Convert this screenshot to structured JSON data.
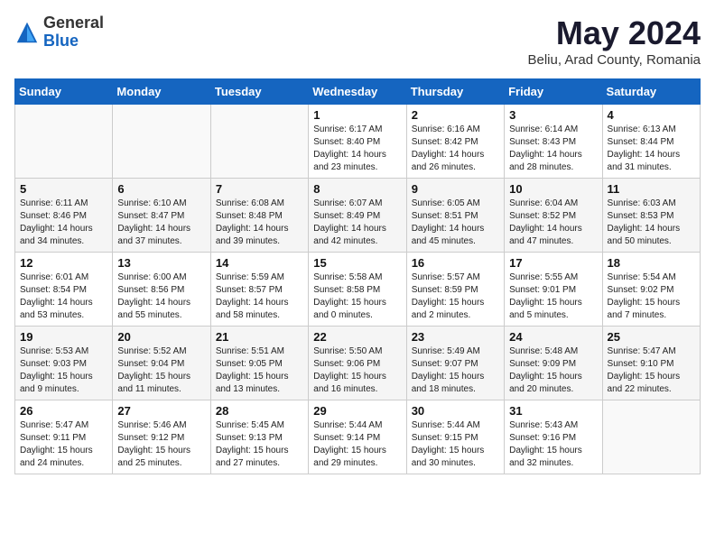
{
  "header": {
    "logo_general": "General",
    "logo_blue": "Blue",
    "month_title": "May 2024",
    "subtitle": "Beliu, Arad County, Romania"
  },
  "weekdays": [
    "Sunday",
    "Monday",
    "Tuesday",
    "Wednesday",
    "Thursday",
    "Friday",
    "Saturday"
  ],
  "weeks": [
    [
      {
        "day": "",
        "info": ""
      },
      {
        "day": "",
        "info": ""
      },
      {
        "day": "",
        "info": ""
      },
      {
        "day": "1",
        "info": "Sunrise: 6:17 AM\nSunset: 8:40 PM\nDaylight: 14 hours\nand 23 minutes."
      },
      {
        "day": "2",
        "info": "Sunrise: 6:16 AM\nSunset: 8:42 PM\nDaylight: 14 hours\nand 26 minutes."
      },
      {
        "day": "3",
        "info": "Sunrise: 6:14 AM\nSunset: 8:43 PM\nDaylight: 14 hours\nand 28 minutes."
      },
      {
        "day": "4",
        "info": "Sunrise: 6:13 AM\nSunset: 8:44 PM\nDaylight: 14 hours\nand 31 minutes."
      }
    ],
    [
      {
        "day": "5",
        "info": "Sunrise: 6:11 AM\nSunset: 8:46 PM\nDaylight: 14 hours\nand 34 minutes."
      },
      {
        "day": "6",
        "info": "Sunrise: 6:10 AM\nSunset: 8:47 PM\nDaylight: 14 hours\nand 37 minutes."
      },
      {
        "day": "7",
        "info": "Sunrise: 6:08 AM\nSunset: 8:48 PM\nDaylight: 14 hours\nand 39 minutes."
      },
      {
        "day": "8",
        "info": "Sunrise: 6:07 AM\nSunset: 8:49 PM\nDaylight: 14 hours\nand 42 minutes."
      },
      {
        "day": "9",
        "info": "Sunrise: 6:05 AM\nSunset: 8:51 PM\nDaylight: 14 hours\nand 45 minutes."
      },
      {
        "day": "10",
        "info": "Sunrise: 6:04 AM\nSunset: 8:52 PM\nDaylight: 14 hours\nand 47 minutes."
      },
      {
        "day": "11",
        "info": "Sunrise: 6:03 AM\nSunset: 8:53 PM\nDaylight: 14 hours\nand 50 minutes."
      }
    ],
    [
      {
        "day": "12",
        "info": "Sunrise: 6:01 AM\nSunset: 8:54 PM\nDaylight: 14 hours\nand 53 minutes."
      },
      {
        "day": "13",
        "info": "Sunrise: 6:00 AM\nSunset: 8:56 PM\nDaylight: 14 hours\nand 55 minutes."
      },
      {
        "day": "14",
        "info": "Sunrise: 5:59 AM\nSunset: 8:57 PM\nDaylight: 14 hours\nand 58 minutes."
      },
      {
        "day": "15",
        "info": "Sunrise: 5:58 AM\nSunset: 8:58 PM\nDaylight: 15 hours\nand 0 minutes."
      },
      {
        "day": "16",
        "info": "Sunrise: 5:57 AM\nSunset: 8:59 PM\nDaylight: 15 hours\nand 2 minutes."
      },
      {
        "day": "17",
        "info": "Sunrise: 5:55 AM\nSunset: 9:01 PM\nDaylight: 15 hours\nand 5 minutes."
      },
      {
        "day": "18",
        "info": "Sunrise: 5:54 AM\nSunset: 9:02 PM\nDaylight: 15 hours\nand 7 minutes."
      }
    ],
    [
      {
        "day": "19",
        "info": "Sunrise: 5:53 AM\nSunset: 9:03 PM\nDaylight: 15 hours\nand 9 minutes."
      },
      {
        "day": "20",
        "info": "Sunrise: 5:52 AM\nSunset: 9:04 PM\nDaylight: 15 hours\nand 11 minutes."
      },
      {
        "day": "21",
        "info": "Sunrise: 5:51 AM\nSunset: 9:05 PM\nDaylight: 15 hours\nand 13 minutes."
      },
      {
        "day": "22",
        "info": "Sunrise: 5:50 AM\nSunset: 9:06 PM\nDaylight: 15 hours\nand 16 minutes."
      },
      {
        "day": "23",
        "info": "Sunrise: 5:49 AM\nSunset: 9:07 PM\nDaylight: 15 hours\nand 18 minutes."
      },
      {
        "day": "24",
        "info": "Sunrise: 5:48 AM\nSunset: 9:09 PM\nDaylight: 15 hours\nand 20 minutes."
      },
      {
        "day": "25",
        "info": "Sunrise: 5:47 AM\nSunset: 9:10 PM\nDaylight: 15 hours\nand 22 minutes."
      }
    ],
    [
      {
        "day": "26",
        "info": "Sunrise: 5:47 AM\nSunset: 9:11 PM\nDaylight: 15 hours\nand 24 minutes."
      },
      {
        "day": "27",
        "info": "Sunrise: 5:46 AM\nSunset: 9:12 PM\nDaylight: 15 hours\nand 25 minutes."
      },
      {
        "day": "28",
        "info": "Sunrise: 5:45 AM\nSunset: 9:13 PM\nDaylight: 15 hours\nand 27 minutes."
      },
      {
        "day": "29",
        "info": "Sunrise: 5:44 AM\nSunset: 9:14 PM\nDaylight: 15 hours\nand 29 minutes."
      },
      {
        "day": "30",
        "info": "Sunrise: 5:44 AM\nSunset: 9:15 PM\nDaylight: 15 hours\nand 30 minutes."
      },
      {
        "day": "31",
        "info": "Sunrise: 5:43 AM\nSunset: 9:16 PM\nDaylight: 15 hours\nand 32 minutes."
      },
      {
        "day": "",
        "info": ""
      }
    ]
  ]
}
